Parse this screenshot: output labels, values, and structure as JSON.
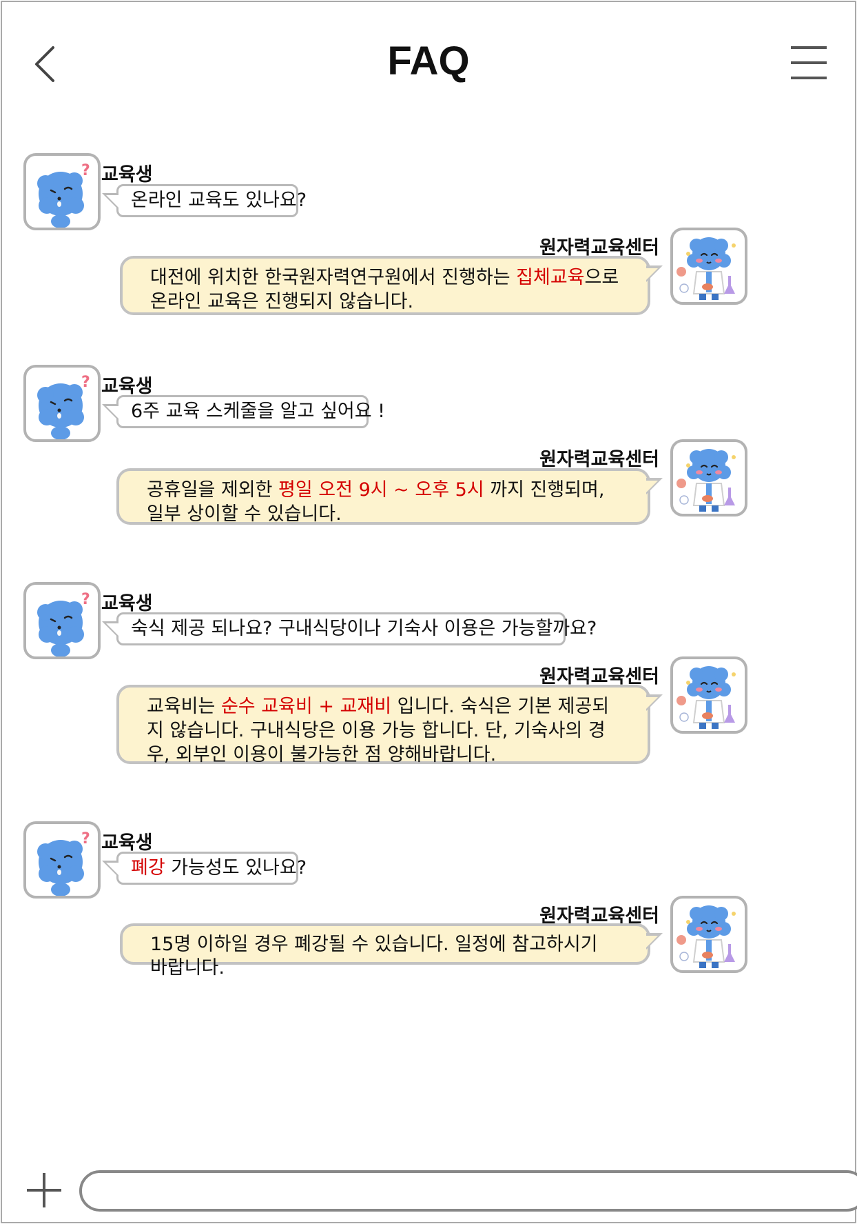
{
  "header": {
    "title": "FAQ",
    "back_icon": "chevron-left-icon",
    "menu_icon": "hamburger-menu-icon"
  },
  "colors": {
    "highlight": "#d40000",
    "answer_bubble_bg": "#fdf3cf",
    "border_gray": "#b9b9b9",
    "mascot_blue": "#5d9be6"
  },
  "qa": [
    {
      "question": {
        "name": "교육생",
        "parts": [
          {
            "text": "온라인 교육도 있나요?",
            "hl": false
          }
        ]
      },
      "answer": {
        "name": "원자력교육센터",
        "parts": [
          {
            "text": "대전에 위치한 한국원자력연구원에서 진행하는 ",
            "hl": false
          },
          {
            "text": "집체교육",
            "hl": true
          },
          {
            "text": "으로 온라인 교육은 진행되지 않습니다.",
            "hl": false
          }
        ]
      }
    },
    {
      "question": {
        "name": "교육생",
        "parts": [
          {
            "text": "6주 교육 스케줄을 알고 싶어요 !",
            "hl": false
          }
        ]
      },
      "answer": {
        "name": "원자력교육센터",
        "parts": [
          {
            "text": "공휴일을 제외한 ",
            "hl": false
          },
          {
            "text": "평일 오전 9시 ~ 오후 5시",
            "hl": true
          },
          {
            "text": " 까지 진행되며, 일부 상이할 수 있습니다.",
            "hl": false
          }
        ]
      }
    },
    {
      "question": {
        "name": "교육생",
        "parts": [
          {
            "text": "숙식 제공 되나요? 구내식당이나 기숙사 이용은 가능할까요?",
            "hl": false
          }
        ]
      },
      "answer": {
        "name": "원자력교육센터",
        "parts": [
          {
            "text": "교육비는 ",
            "hl": false
          },
          {
            "text": "순수 교육비 + 교재비",
            "hl": true
          },
          {
            "text": " 입니다. 숙식은 기본 제공되지 않습니다. 구내식당은 이용 가능 합니다. 단, 기숙사의 경우, 외부인 이용이 불가능한 점 양해바랍니다.",
            "hl": false
          }
        ]
      }
    },
    {
      "question": {
        "name": "교육생",
        "parts": [
          {
            "text": "폐강",
            "hl": true
          },
          {
            "text": " 가능성도 있나요?",
            "hl": false
          }
        ]
      },
      "answer": {
        "name": "원자력교육센터",
        "parts": [
          {
            "text": "15명 이하일 경우 폐강될 수 있습니다. 일정에 참고하시기 바랍니다.",
            "hl": false
          }
        ]
      }
    }
  ],
  "footer": {
    "plus_icon": "plus-icon",
    "input_value": ""
  }
}
